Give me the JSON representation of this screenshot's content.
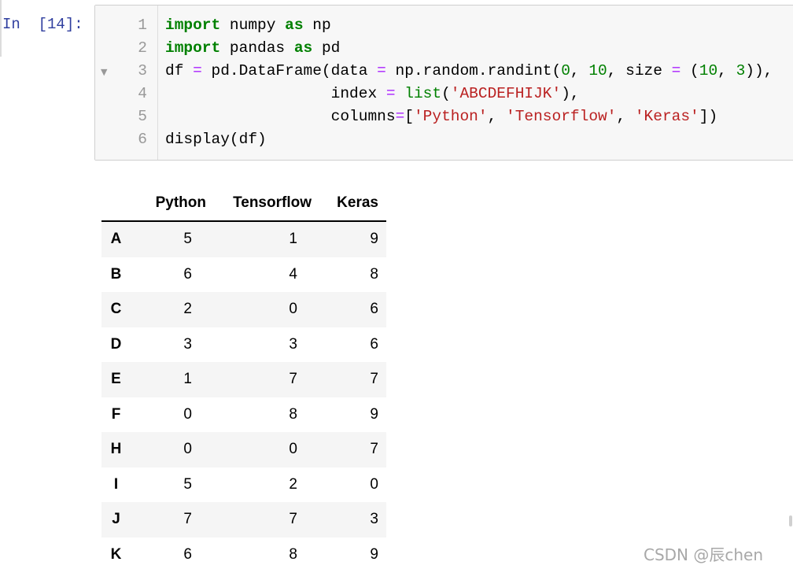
{
  "cell": {
    "prompt": "In  [14]:",
    "lines": [
      {
        "n": "1",
        "parts": [
          {
            "t": "import",
            "c": "kw"
          },
          {
            "t": " numpy ",
            "c": ""
          },
          {
            "t": "as",
            "c": "kw"
          },
          {
            "t": " np",
            "c": ""
          }
        ]
      },
      {
        "n": "2",
        "parts": [
          {
            "t": "import",
            "c": "kw"
          },
          {
            "t": " pandas ",
            "c": ""
          },
          {
            "t": "as",
            "c": "kw"
          },
          {
            "t": " pd",
            "c": ""
          }
        ]
      },
      {
        "n": "3",
        "parts": [
          {
            "t": "df ",
            "c": ""
          },
          {
            "t": "=",
            "c": "op"
          },
          {
            "t": " pd.DataFrame(data ",
            "c": ""
          },
          {
            "t": "=",
            "c": "op"
          },
          {
            "t": " np.random.randint(",
            "c": ""
          },
          {
            "t": "0",
            "c": "num"
          },
          {
            "t": ", ",
            "c": ""
          },
          {
            "t": "10",
            "c": "num"
          },
          {
            "t": ", size ",
            "c": ""
          },
          {
            "t": "=",
            "c": "op"
          },
          {
            "t": " (",
            "c": ""
          },
          {
            "t": "10",
            "c": "num"
          },
          {
            "t": ", ",
            "c": ""
          },
          {
            "t": "3",
            "c": "num"
          },
          {
            "t": ")),",
            "c": ""
          }
        ]
      },
      {
        "n": "4",
        "parts": [
          {
            "t": "                  index ",
            "c": ""
          },
          {
            "t": "=",
            "c": "op"
          },
          {
            "t": " ",
            "c": ""
          },
          {
            "t": "list",
            "c": "bi"
          },
          {
            "t": "(",
            "c": ""
          },
          {
            "t": "'ABCDEFHIJK'",
            "c": "str"
          },
          {
            "t": "),",
            "c": ""
          }
        ]
      },
      {
        "n": "5",
        "parts": [
          {
            "t": "                  columns",
            "c": ""
          },
          {
            "t": "=",
            "c": "op"
          },
          {
            "t": "[",
            "c": ""
          },
          {
            "t": "'Python'",
            "c": "str"
          },
          {
            "t": ", ",
            "c": ""
          },
          {
            "t": "'Tensorflow'",
            "c": "str"
          },
          {
            "t": ", ",
            "c": ""
          },
          {
            "t": "'Keras'",
            "c": "str"
          },
          {
            "t": "])",
            "c": ""
          }
        ]
      },
      {
        "n": "6",
        "parts": [
          {
            "t": "display(df)",
            "c": ""
          }
        ]
      }
    ]
  },
  "output": {
    "columns": [
      "Python",
      "Tensorflow",
      "Keras"
    ],
    "rows": [
      {
        "index": "A",
        "values": [
          "5",
          "1",
          "9"
        ]
      },
      {
        "index": "B",
        "values": [
          "6",
          "4",
          "8"
        ]
      },
      {
        "index": "C",
        "values": [
          "2",
          "0",
          "6"
        ]
      },
      {
        "index": "D",
        "values": [
          "3",
          "3",
          "6"
        ]
      },
      {
        "index": "E",
        "values": [
          "1",
          "7",
          "7"
        ]
      },
      {
        "index": "F",
        "values": [
          "0",
          "8",
          "9"
        ]
      },
      {
        "index": "H",
        "values": [
          "0",
          "0",
          "7"
        ]
      },
      {
        "index": "I",
        "values": [
          "5",
          "2",
          "0"
        ]
      },
      {
        "index": "J",
        "values": [
          "7",
          "7",
          "3"
        ]
      },
      {
        "index": "K",
        "values": [
          "6",
          "8",
          "9"
        ]
      }
    ]
  },
  "watermark": "CSDN @辰chen",
  "icons": {
    "fold": "fold-arrow-icon"
  }
}
